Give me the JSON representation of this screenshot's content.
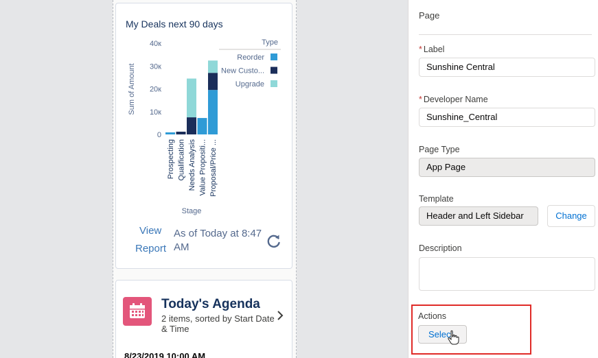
{
  "chart_card": {
    "title": "My Deals next 90 days",
    "link_view": "View",
    "link_report": "Report",
    "as_of": "As of Today at 8:47 AM"
  },
  "chart_data": {
    "type": "bar",
    "stacked": true,
    "ylabel": "Sum of Amount",
    "xlabel": "Stage",
    "ylim": [
      0,
      40000
    ],
    "yticks": [
      0,
      10000,
      20000,
      30000,
      40000
    ],
    "ytick_labels": [
      "0",
      "10к",
      "20к",
      "30к",
      "40к"
    ],
    "categories": [
      "Prospecting",
      "Qualification",
      "Needs Analysis",
      "Value Propositi...",
      "Proposal/Price ..."
    ],
    "legend_title": "Type",
    "legend_position": "right",
    "series": [
      {
        "name": "Reorder",
        "color": "#2f9bd6",
        "values": [
          900,
          0,
          0,
          7200,
          19500
        ]
      },
      {
        "name": "New Custo...",
        "color": "#1b2e5a",
        "values": [
          0,
          1200,
          7500,
          0,
          7500
        ]
      },
      {
        "name": "Upgrade",
        "color": "#8fd8d8",
        "values": [
          0,
          0,
          17000,
          0,
          5400
        ]
      }
    ]
  },
  "agenda_card": {
    "title": "Today's Agenda",
    "subtitle": "2 items, sorted by Start Date & Time",
    "first_item_date": "8/23/2019 10:00 AM",
    "icon": "calendar-icon",
    "icon_color": "#e3567b"
  },
  "panel": {
    "header": "Page",
    "label_label": "Label",
    "label_value": "Sunshine Central",
    "devname_label": "Developer Name",
    "devname_value": "Sunshine_Central",
    "pagetype_label": "Page Type",
    "pagetype_value": "App Page",
    "template_label": "Template",
    "template_value": "Header and Left Sidebar",
    "change_button": "Change",
    "description_label": "Description",
    "description_value": "",
    "actions_label": "Actions",
    "select_button": "Select"
  },
  "colors": {
    "highlight": "#e02a27",
    "link": "#0070d2",
    "required": "#c23934"
  }
}
